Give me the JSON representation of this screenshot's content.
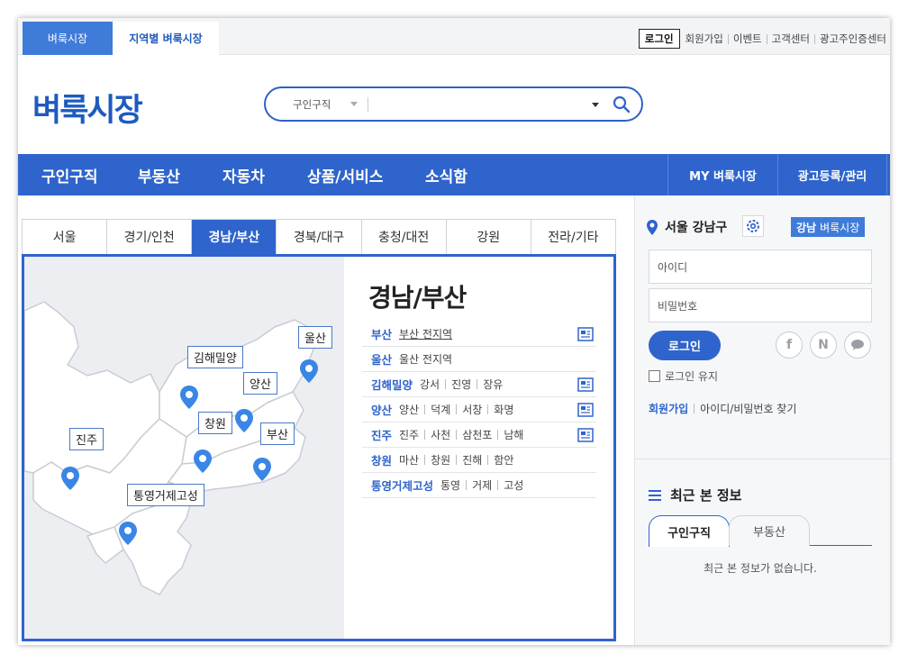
{
  "topbar": {
    "tabs": [
      "벼룩시장",
      "지역별 벼룩시장"
    ],
    "links": [
      "로그인",
      "회원가입",
      "이벤트",
      "고객센터",
      "광고주인증센터"
    ]
  },
  "header": {
    "logo": "벼룩시장",
    "search": {
      "category": "구인구직",
      "query": ""
    }
  },
  "nav": {
    "items": [
      "구인구직",
      "부동산",
      "자동차",
      "상품/서비스",
      "소식함"
    ],
    "right": [
      "MY 벼룩시장",
      "광고등록/관리"
    ]
  },
  "regions": {
    "tabs": [
      "서울",
      "경기/인천",
      "경남/부산",
      "경북/대구",
      "충청/대전",
      "강원",
      "전라/기타"
    ],
    "active": "경남/부산",
    "map_labels": [
      "울산",
      "김해밀양",
      "양산",
      "창원",
      "부산",
      "진주",
      "통영거제고성"
    ],
    "panel_title": "경남/부산",
    "rows": [
      {
        "name": "부산",
        "subs": [
          "부산 전지역"
        ]
      },
      {
        "name": "울산",
        "subs": [
          "울산 전지역"
        ]
      },
      {
        "name": "김해밀양",
        "subs": [
          "강서",
          "진영",
          "장유"
        ]
      },
      {
        "name": "양산",
        "subs": [
          "양산",
          "덕계",
          "서창",
          "화명"
        ]
      },
      {
        "name": "진주",
        "subs": [
          "진주",
          "사천",
          "삼천포",
          "남해"
        ]
      },
      {
        "name": "창원",
        "subs": [
          "마산",
          "창원",
          "진해",
          "함안"
        ]
      },
      {
        "name": "통영거제고성",
        "subs": [
          "통영",
          "거제",
          "고성"
        ]
      }
    ]
  },
  "sidebar": {
    "location": "서울 강남구",
    "badge_region": "강남",
    "badge_text": "벼룩시장",
    "id_placeholder": "아이디",
    "pw_placeholder": "비밀번호",
    "login_button": "로그인",
    "social": [
      "f",
      "N",
      "talk"
    ],
    "keep_login": "로그인 유지",
    "join": "회원가입",
    "find": "아이디/비밀번호 찾기",
    "recent_title": "최근 본 정보",
    "recent_tabs": [
      "구인구직",
      "부동산"
    ],
    "recent_empty": "최근 본 정보가 없습니다."
  },
  "colors": {
    "brand": "#2e64cc",
    "accent": "#3f7bd9",
    "map_bg": "#eceef2",
    "pin": "#3a86e6"
  }
}
